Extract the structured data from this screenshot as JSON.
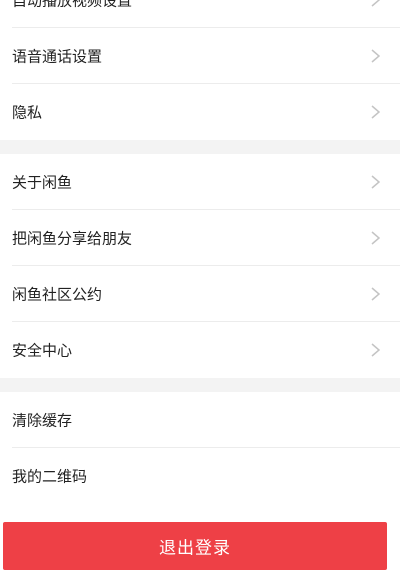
{
  "settings_group_1": {
    "items": [
      {
        "label": "自动播放视频设置"
      },
      {
        "label": "语音通话设置"
      },
      {
        "label": "隐私"
      }
    ]
  },
  "settings_group_2": {
    "items": [
      {
        "label": "关于闲鱼"
      },
      {
        "label": "把闲鱼分享给朋友"
      },
      {
        "label": "闲鱼社区公约"
      },
      {
        "label": "安全中心"
      }
    ]
  },
  "settings_group_3": {
    "items": [
      {
        "label": "清除缓存"
      },
      {
        "label": "我的二维码"
      }
    ]
  },
  "logout": {
    "label": "退出登录",
    "color": "#ee4046"
  },
  "icons": {
    "row_chevron": "chevron-right-icon"
  }
}
